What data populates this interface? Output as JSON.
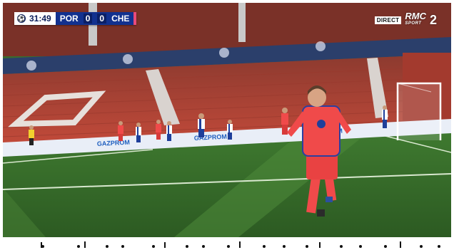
{
  "scorebug": {
    "clock": "31:49",
    "home_team": "POR",
    "home_score": "0",
    "away_score": "0",
    "away_team": "CHE",
    "icon": "champions-league-ball-icon"
  },
  "broadcaster": {
    "live_tag": "DIRECT",
    "channel_name": "RMC",
    "channel_sub": "SPORT",
    "channel_number": "2"
  },
  "board": {
    "sponsor": "GAZPROM"
  },
  "colors": {
    "pitch_dark": "#2f5f26",
    "pitch_light": "#4f8a3a",
    "stand_seats": "#b84235",
    "chelsea_kit": "#f04a4a",
    "porto_kit": "#1f3f9a",
    "scorebug_blue": "#12318f"
  }
}
